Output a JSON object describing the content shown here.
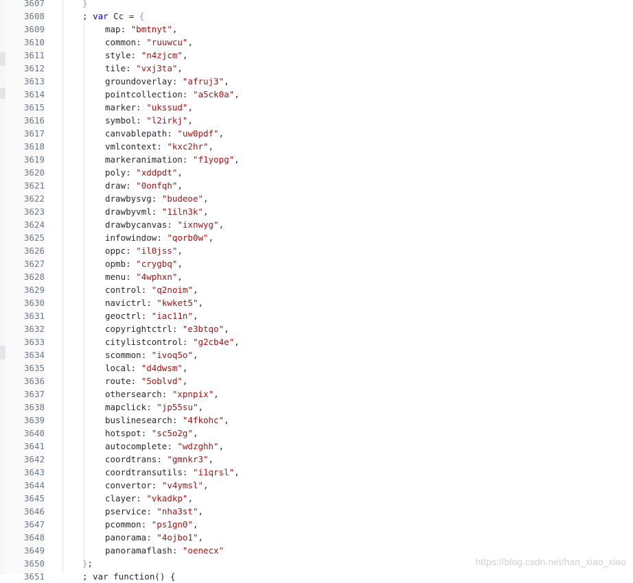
{
  "editor": {
    "top_line": {
      "number": "3607",
      "text": "}"
    },
    "declaration": {
      "number": "3608",
      "prefix": "; ",
      "keyword": "var",
      "name": " Cc = ",
      "brace": "{"
    },
    "entries": [
      {
        "number": "3609",
        "key": "map",
        "value": "\"bmtnyt\""
      },
      {
        "number": "3610",
        "key": "common",
        "value": "\"ruuwcu\""
      },
      {
        "number": "3611",
        "key": "style",
        "value": "\"n4zjcm\""
      },
      {
        "number": "3612",
        "key": "tile",
        "value": "\"vxj3ta\""
      },
      {
        "number": "3613",
        "key": "groundoverlay",
        "value": "\"afruj3\""
      },
      {
        "number": "3614",
        "key": "pointcollection",
        "value": "\"a5ck0a\""
      },
      {
        "number": "3615",
        "key": "marker",
        "value": "\"ukssud\""
      },
      {
        "number": "3616",
        "key": "symbol",
        "value": "\"l2irkj\""
      },
      {
        "number": "3617",
        "key": "canvablepath",
        "value": "\"uw0pdf\""
      },
      {
        "number": "3618",
        "key": "vmlcontext",
        "value": "\"kxc2hr\""
      },
      {
        "number": "3619",
        "key": "markeranimation",
        "value": "\"f1yopg\""
      },
      {
        "number": "3620",
        "key": "poly",
        "value": "\"xddpdt\""
      },
      {
        "number": "3621",
        "key": "draw",
        "value": "\"0onfqh\""
      },
      {
        "number": "3622",
        "key": "drawbysvg",
        "value": "\"budeoe\""
      },
      {
        "number": "3623",
        "key": "drawbyvml",
        "value": "\"1iln3k\""
      },
      {
        "number": "3624",
        "key": "drawbycanvas",
        "value": "\"ixnwyg\""
      },
      {
        "number": "3625",
        "key": "infowindow",
        "value": "\"qorb0w\""
      },
      {
        "number": "3626",
        "key": "oppc",
        "value": "\"il0jss\""
      },
      {
        "number": "3627",
        "key": "opmb",
        "value": "\"crygbq\""
      },
      {
        "number": "3628",
        "key": "menu",
        "value": "\"4wphxn\""
      },
      {
        "number": "3629",
        "key": "control",
        "value": "\"q2noim\""
      },
      {
        "number": "3630",
        "key": "navictrl",
        "value": "\"kwket5\""
      },
      {
        "number": "3631",
        "key": "geoctrl",
        "value": "\"iac11n\""
      },
      {
        "number": "3632",
        "key": "copyrightctrl",
        "value": "\"e3btqo\""
      },
      {
        "number": "3633",
        "key": "citylistcontrol",
        "value": "\"g2cb4e\""
      },
      {
        "number": "3634",
        "key": "scommon",
        "value": "\"ivoq5o\""
      },
      {
        "number": "3635",
        "key": "local",
        "value": "\"d4dwsm\""
      },
      {
        "number": "3636",
        "key": "route",
        "value": "\"5oblvd\""
      },
      {
        "number": "3637",
        "key": "othersearch",
        "value": "\"xpnpix\""
      },
      {
        "number": "3638",
        "key": "mapclick",
        "value": "\"jp55su\""
      },
      {
        "number": "3639",
        "key": "buslinesearch",
        "value": "\"4fkohc\""
      },
      {
        "number": "3640",
        "key": "hotspot",
        "value": "\"sc5o2g\""
      },
      {
        "number": "3641",
        "key": "autocomplete",
        "value": "\"wdzghh\""
      },
      {
        "number": "3642",
        "key": "coordtrans",
        "value": "\"gmnkr3\""
      },
      {
        "number": "3643",
        "key": "coordtransutils",
        "value": "\"i1qrsl\""
      },
      {
        "number": "3644",
        "key": "convertor",
        "value": "\"v4ymsl\""
      },
      {
        "number": "3645",
        "key": "clayer",
        "value": "\"vkadkp\""
      },
      {
        "number": "3646",
        "key": "pservice",
        "value": "\"nha3st\""
      },
      {
        "number": "3647",
        "key": "pcommon",
        "value": "\"ps1gn0\""
      },
      {
        "number": "3648",
        "key": "panorama",
        "value": "\"4ojbo1\""
      },
      {
        "number": "3649",
        "key": "panoramaflash",
        "value": "\"oenecx\""
      }
    ],
    "closing": {
      "number": "3650",
      "brace": "}",
      "semicolon": ";"
    },
    "cut_line": {
      "number": "3651",
      "text": "; var function() {"
    },
    "colors": {
      "string": "#a31515",
      "keyword": "#0000ff",
      "brace": "#7aa7d8",
      "line_number": "#6a7a8a"
    }
  },
  "watermark": "https://blog.csdn.net/han_xiao_xiao"
}
